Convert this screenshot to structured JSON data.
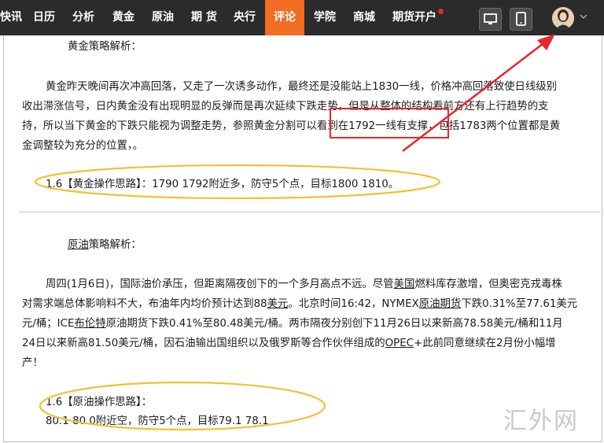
{
  "nav": {
    "items": [
      "快讯",
      "日历",
      "分析",
      "黄金",
      "原油",
      "期 货",
      "央行",
      "评论",
      "学院",
      "商城",
      "期货开户"
    ],
    "active": "评论"
  },
  "gold": {
    "heading": "黄金策略解析：",
    "para_lines": [
      "黄金昨天晚间再次冲高回落，又走了一次诱多动作，最终还是没能站上1830一线，价格冲高回落致使日线级别",
      "收出滞涨信号，日内黄金没有出现明显的反弹而是再次延续下跌走势，但是从整体的结构看前方还有上行趋势的支",
      "持，所以当下黄金的下跌只能视为调整走势，参照黄金分割可以看到在1792一线有支撑，包括1783两个位置都是黄",
      "金调整较为充分的位置，。"
    ],
    "strategy": "1.6【黄金操作思路】：1790  1792附近多，防守5个点，目标1800  1810。"
  },
  "oil": {
    "heading_link": "原油",
    "heading_rest": "策略解析：",
    "line1": "周四(1月6日)，国际油价承压，但距离隔夜创下的一个多月高点不远。尽管",
    "line1_link": "美国",
    "line1_tail": "燃料库存激增，但奥密克戎毒株",
    "line2_a": "对需求端总体影响料不大，布油年内均价预计达到88",
    "line2_link": "美元",
    "line2_b": "。北京时间16:42，NYMEX",
    "line2_link2": "原油期货",
    "line2_c": "下跌0.31%至77.61美元",
    "line3_a": "元/桶；ICE",
    "line3_link": "布伦特",
    "line3_b": "原油期货下跌0.41%至80.48美元/桶。两市隔夜分别创下11月26日以来新高78.58美元/桶和11月",
    "line4_a": "24日以来新高81.50美元/桶，因石油输出国组织以及俄罗斯等合作伙伴组成的",
    "line4_link": "OPEC",
    "line4_b": "+此前同意继续在2月份小幅增",
    "line5": "产！",
    "strategy_title": "1.6【原油操作思路】：",
    "strategy_detail": "80.1   80.0附近空，防守5个点，目标79.1  78.1"
  },
  "watermark": "汇外网",
  "colors": {
    "nav_bg": "#2b2b2b",
    "nav_active": "#f26c22",
    "annotation_red": "#e8262d",
    "annotation_yellow": "#f2c12e"
  }
}
